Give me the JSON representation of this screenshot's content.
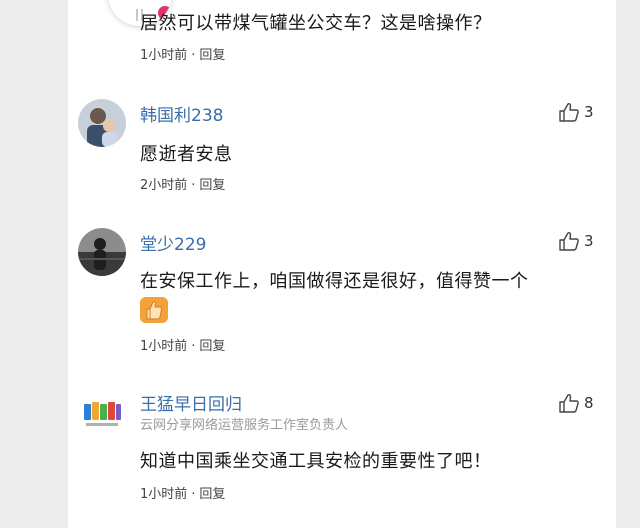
{
  "comments": [
    {
      "text": "居然可以带煤气罐坐公交车？这是啥操作？",
      "time": "1小时前",
      "reply": "回复"
    },
    {
      "username": "韩国利238",
      "text": "愿逝者安息",
      "time": "2小时前",
      "reply": "回复",
      "likes": "3"
    },
    {
      "username": "堂少229",
      "text": "在安保工作上，咱国做得还是很好，值得赞一个",
      "time": "1小时前",
      "reply": "回复",
      "likes": "3"
    },
    {
      "username": "王猛早日回归",
      "user_note": "云网分享网络运营服务工作室负责人",
      "text": "知道中国乘坐交通工具安检的重要性了吧！",
      "time": "1小时前",
      "reply": "回复",
      "likes": "8"
    }
  ],
  "meta_separator": "·",
  "colors": {
    "username": "#3a6ea8",
    "text": "#1a1a1a",
    "meta": "#444444",
    "background": "#ececec"
  }
}
